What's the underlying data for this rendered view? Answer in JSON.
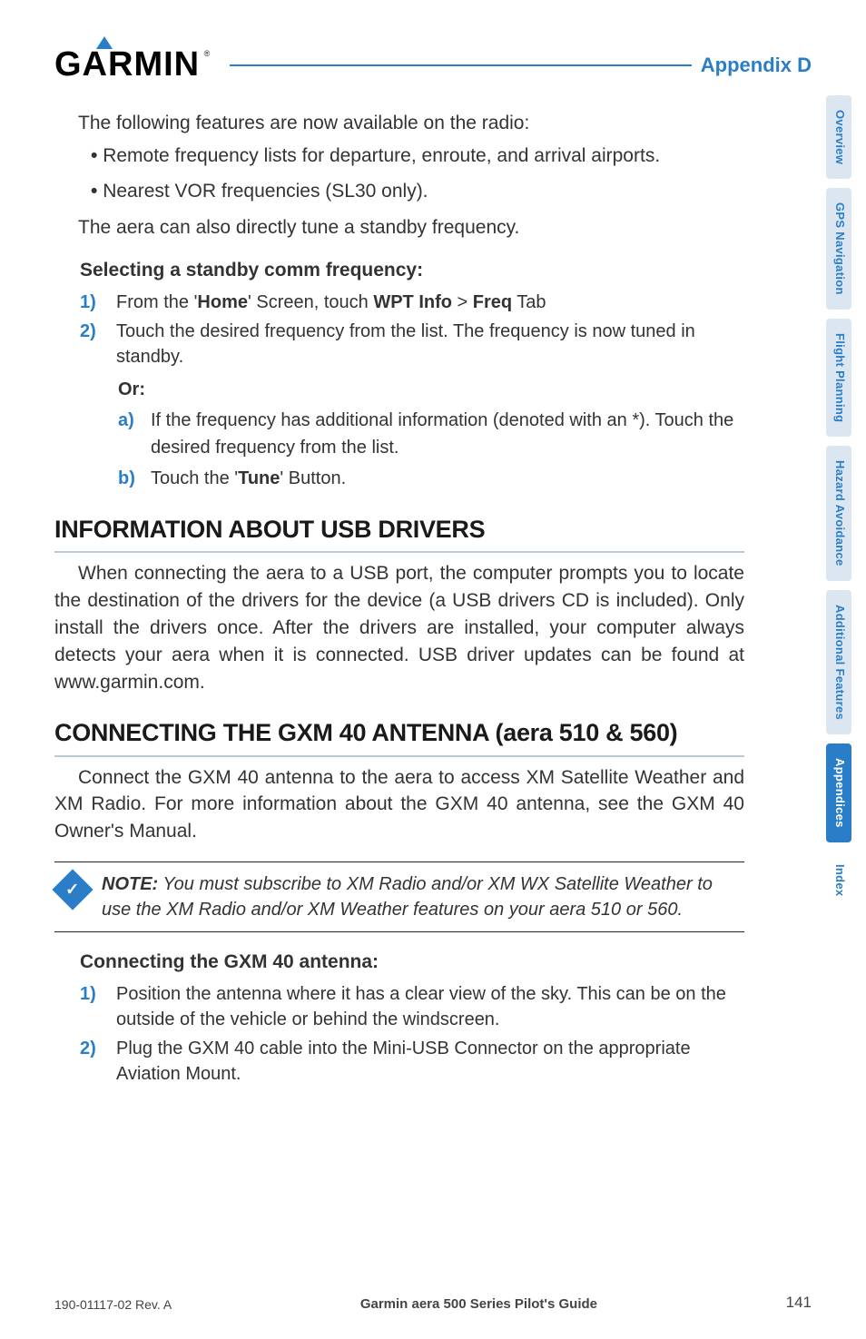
{
  "header": {
    "logo_text": "GARMIN",
    "logo_reg": "®",
    "appendix": "Appendix D"
  },
  "tabs": {
    "overview": "Overview",
    "gps": "GPS Navigation",
    "flight": "Flight Planning",
    "hazard": "Hazard Avoidance",
    "additional": "Additional Features",
    "appendices": "Appendices",
    "index": "Index"
  },
  "intro": {
    "lead": "The following features are now available on the radio:",
    "bullet1": "Remote frequency lists for departure, enroute, and arrival airports.",
    "bullet2": "Nearest VOR frequencies (SL30 only).",
    "after": "The aera can also directly tune a standby frequency."
  },
  "standby": {
    "heading": "Selecting a standby comm frequency:",
    "step1_num": "1)",
    "step1_pre": "From the '",
    "step1_home": "Home",
    "step1_mid": "' Screen, touch ",
    "step1_wpt": "WPT Info",
    "step1_gt": " > ",
    "step1_freq": "Freq",
    "step1_post": " Tab",
    "step2_num": "2)",
    "step2": "Touch the desired frequency from the list.  The frequency is now tuned in standby.",
    "or": "Or:",
    "sub_a_num": "a)",
    "sub_a": "If the frequency has additional information (denoted with an *).  Touch the desired frequency from the list.",
    "sub_b_num": "b)",
    "sub_b_pre": "Touch the '",
    "sub_b_tune": "Tune",
    "sub_b_post": "' Button."
  },
  "usb": {
    "heading": "INFORMATION ABOUT USB DRIVERS",
    "body": "When connecting the aera to a USB port, the computer prompts you to locate the destination of the drivers for the device (a USB drivers CD is included).  Only install the drivers once.  After the drivers are installed, your computer always detects your aera when it is connected.  USB driver updates can be found at www.garmin.com."
  },
  "gxm": {
    "heading": "CONNECTING THE GXM 40 ANTENNA (aera 510 & 560)",
    "body": "Connect the GXM 40 antenna to the aera to access XM Satellite Weather and XM Radio.  For more information about the GXM 40 antenna, see the GXM 40 Owner's Manual.",
    "note_label": "NOTE:",
    "note_body": " You must subscribe to XM Radio and/or XM WX Satellite Weather to use the XM Radio and/or XM Weather features on your aera 510 or 560.",
    "conn_heading": "Connecting the GXM 40 antenna:",
    "conn1_num": "1)",
    "conn1": "Position the antenna where it has a clear view of the sky.  This can be on the outside of the vehicle or behind the windscreen.",
    "conn2_num": "2)",
    "conn2": "Plug the GXM 40 cable into the Mini-USB Connector on the appropriate Aviation Mount."
  },
  "footer": {
    "left": "190-01117-02 Rev. A",
    "center": "Garmin aera 500 Series Pilot's Guide",
    "page": "141"
  },
  "icons": {
    "check": "✓"
  }
}
